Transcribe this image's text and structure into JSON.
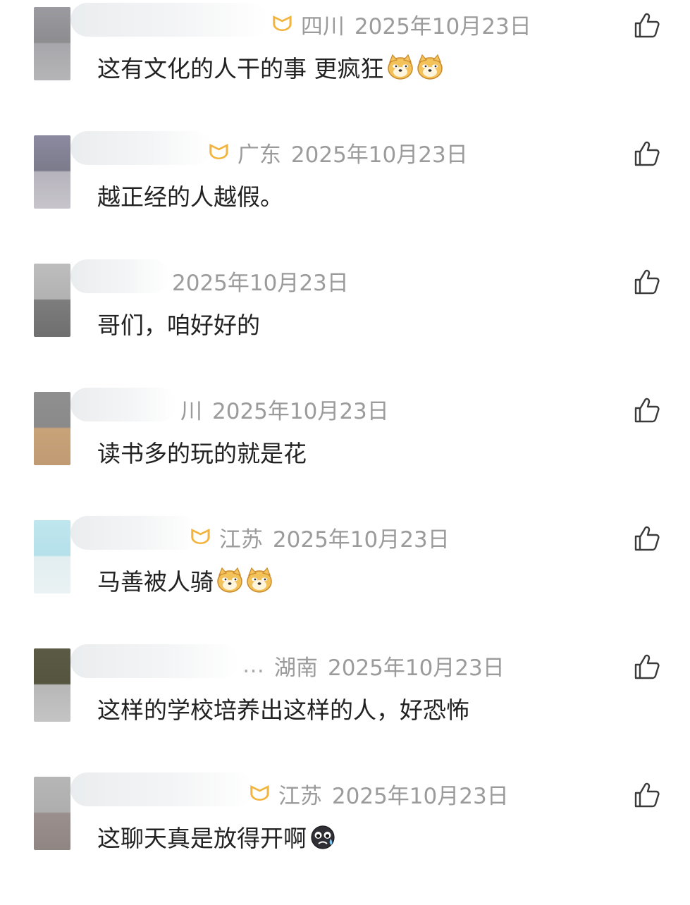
{
  "comments": [
    {
      "region": "四川",
      "date": "2025年10月23日",
      "text": "这有文化的人干的事 更疯狂",
      "emojis": [
        "doge-icon",
        "doge-icon"
      ],
      "vip": true,
      "more": ""
    },
    {
      "region": "广东",
      "date": "2025年10月23日",
      "text": "越正经的人越假。",
      "emojis": [],
      "vip": true,
      "more": ""
    },
    {
      "region": "",
      "date": "2025年10月23日",
      "text": "哥们，咱好好的",
      "emojis": [],
      "vip": false,
      "more": ""
    },
    {
      "region": "川",
      "date": "2025年10月23日",
      "text": "读书多的玩的就是花",
      "emojis": [],
      "vip": false,
      "more": ""
    },
    {
      "region": "江苏",
      "date": "2025年10月23日",
      "text": "马善被人骑",
      "emojis": [
        "doge-icon",
        "doge-icon"
      ],
      "vip": true,
      "more": ""
    },
    {
      "region": "湖南",
      "date": "2025年10月23日",
      "text": "这样的学校培养出这样的人，好恐怖",
      "emojis": [],
      "vip": false,
      "more": "…"
    },
    {
      "region": "江苏",
      "date": "2025年10月23日",
      "text": "这聊天真是放得开啊",
      "emojis": [
        "crying-face-icon"
      ],
      "vip": true,
      "more": ""
    }
  ],
  "icons": {
    "like": "thumbs-up-icon",
    "vip_badge": "vip-badge-icon"
  },
  "colors": {
    "meta_text": "#9b9b9b",
    "content_text": "#222222",
    "vip_badge": "#f3b43e",
    "doge_emoji": "#f4c25a"
  }
}
